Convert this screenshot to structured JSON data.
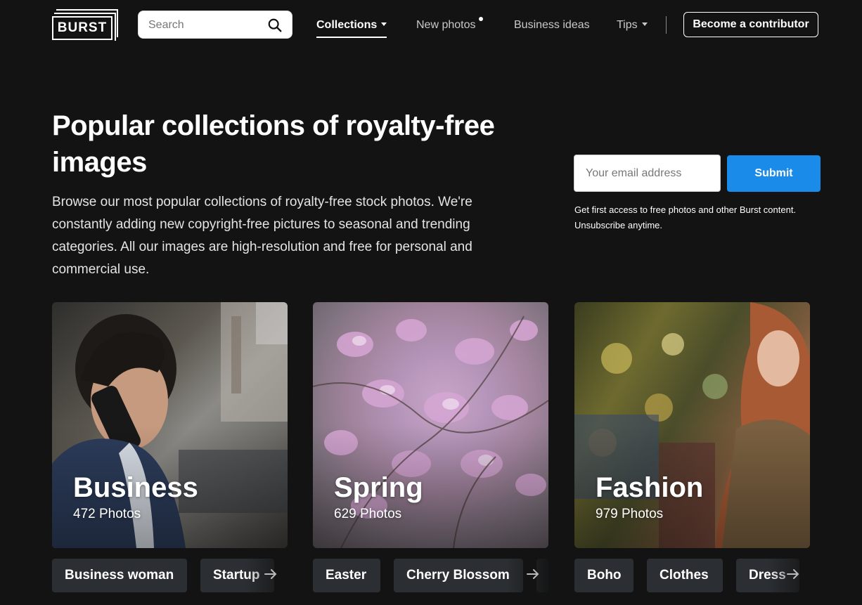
{
  "header": {
    "logo_text": "BURST",
    "search_placeholder": "Search",
    "nav": {
      "collections": "Collections",
      "new_photos": "New photos",
      "business_ideas": "Business ideas",
      "tips": "Tips"
    },
    "contributor_button": "Become a contributor"
  },
  "hero": {
    "title": "Popular collections of royalty-free images",
    "description": "Browse our most popular collections of royalty-free stock photos. We're constantly adding new copyright-free pictures to seasonal and trending categories. All our images are high-resolution and free for personal and commercial use."
  },
  "newsletter": {
    "email_placeholder": "Your email address",
    "submit_label": "Submit",
    "note": "Get first access to free photos and other Burst content. Unsubscribe anytime."
  },
  "collections": [
    {
      "title": "Business",
      "count": "472 Photos",
      "tags": [
        "Business woman",
        "Startup"
      ]
    },
    {
      "title": "Spring",
      "count": "629 Photos",
      "tags": [
        "Easter",
        "Cherry Blossom"
      ]
    },
    {
      "title": "Fashion",
      "count": "979 Photos",
      "tags": [
        "Boho",
        "Clothes",
        "Dress"
      ]
    }
  ]
}
